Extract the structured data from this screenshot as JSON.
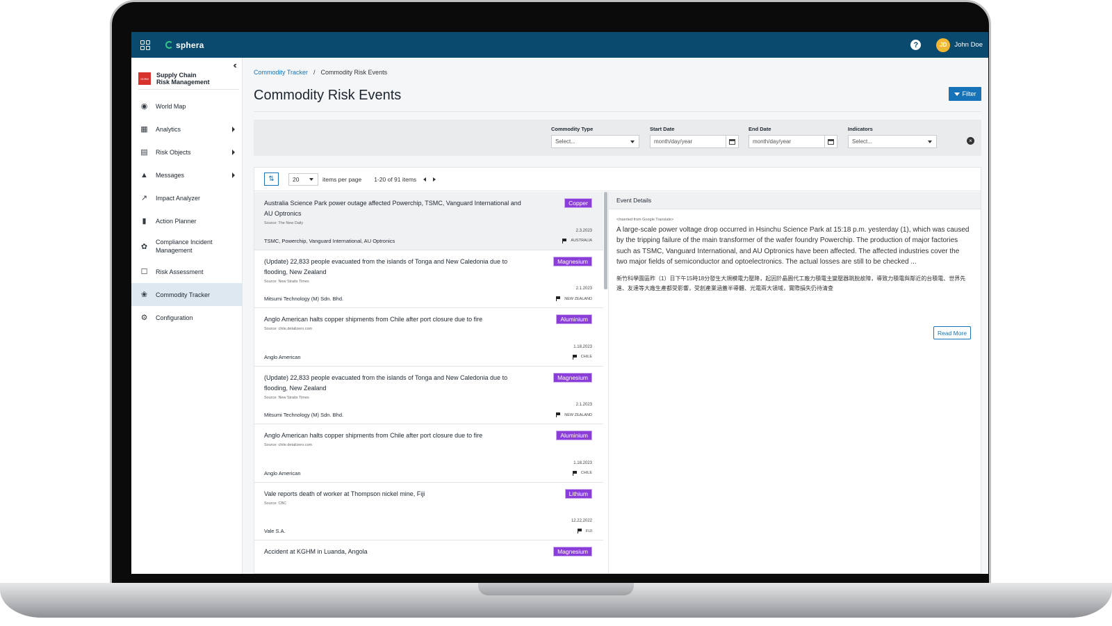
{
  "brand": {
    "name": "sphera"
  },
  "user": {
    "initials": "JD",
    "name": "John Doe"
  },
  "sidebar": {
    "app_logo_text": "SCRM",
    "app_name": "Supply Chain\nRisk Management",
    "items": [
      {
        "label": "World Map",
        "icon": "globe-icon",
        "has_submenu": false
      },
      {
        "label": "Analytics",
        "icon": "bar-chart-icon",
        "has_submenu": true
      },
      {
        "label": "Risk Objects",
        "icon": "table-icon",
        "has_submenu": true
      },
      {
        "label": "Messages",
        "icon": "bell-icon",
        "has_submenu": true
      },
      {
        "label": "Impact Analyzer",
        "icon": "line-chart-icon",
        "has_submenu": false
      },
      {
        "label": "Action Planner",
        "icon": "pin-icon",
        "has_submenu": false
      },
      {
        "label": "Compliance Incident Management",
        "icon": "leaf-icon",
        "has_submenu": false
      },
      {
        "label": "Risk Assessment",
        "icon": "clipboard-icon",
        "has_submenu": false
      },
      {
        "label": "Commodity Tracker",
        "icon": "commodity-icon",
        "has_submenu": false,
        "active": true
      },
      {
        "label": "Configuration",
        "icon": "gear-icon",
        "has_submenu": false
      }
    ]
  },
  "breadcrumb": {
    "parent": "Commodity Tracker",
    "separator": "/",
    "current": "Commodity Risk Events"
  },
  "page": {
    "title": "Commodity Risk Events",
    "filter_button": "Filter"
  },
  "filters": {
    "commodity_type": {
      "label": "Commodity Type",
      "placeholder": "Select..."
    },
    "start_date": {
      "label": "Start Date",
      "placeholder": "month/day/year"
    },
    "end_date": {
      "label": "End Date",
      "placeholder": "month/day/year"
    },
    "indicators": {
      "label": "Indicators",
      "placeholder": "Select..."
    }
  },
  "pagination": {
    "per_page_value": "20",
    "per_page_label": "items per page",
    "range": "1-20 of 91 items"
  },
  "events": [
    {
      "title": "Australia Science Park power outage affected Powerchip, TSMC, Vanguard International and AU Optronics",
      "source": "Source: The New Daily",
      "date": "2.3.2023",
      "companies": "TSMC, Powerchip, Vanguard International, AU Optronics",
      "country": "AUSTRALIA",
      "commodity": "Copper",
      "selected": true
    },
    {
      "title": "(Update) 22,833 people evacuated from the islands of Tonga and New Caledonia due to flooding, New Zealand",
      "source": "Source: New Straits Times",
      "date": "2.1.2023",
      "companies": "Mitsumi Technology (M) Sdn. Bhd.",
      "country": "NEW ZEALAND",
      "commodity": "Magnesium"
    },
    {
      "title": "Anglo American halts copper shipments from Chile after port closure due to fire",
      "source": "Source: chile.detalizero.com",
      "date": "1.18.2023",
      "companies": "Anglo American",
      "country": "CHILE",
      "commodity": "Aluminium"
    },
    {
      "title": "(Update) 22,833 people evacuated from the islands of Tonga and New Caledonia due to flooding, New Zealand",
      "source": "Source: New Straits Times",
      "date": "2.1.2023",
      "companies": "Mitsumi Technology (M) Sdn. Bhd.",
      "country": "NEW ZEALAND",
      "commodity": "Magnesium"
    },
    {
      "title": "Anglo American halts copper shipments from Chile after port closure due to fire",
      "source": "Source: chile.detalizero.com",
      "date": "1.18.2023",
      "companies": "Anglo American",
      "country": "CHILE",
      "commodity": "Aluminium"
    },
    {
      "title": "Vale reports death of worker at Thompson nickel mine, Fiji",
      "source": "Source: CBC",
      "date": "12.22.2022",
      "companies": "Vale S.A.",
      "country": "FIJI",
      "commodity": "Lithium"
    },
    {
      "title": "Accident at KGHM in Luanda, Angola",
      "source": "",
      "date": "",
      "companies": "",
      "country": "",
      "commodity": "Magnesium"
    }
  ],
  "details": {
    "header": "Event Details",
    "note": "<Inserted from Google Translate>",
    "text_en": "A large-scale power voltage drop occurred in Hsinchu Science Park at 15:18 p.m. yesterday (1), which was caused by the tripping failure of the main transformer of the wafer foundry Powerchip. The production of major factories such as TSMC, Vanguard International, and AU Optronics have been affected. The affected industries cover the two major fields of semiconductor and optoelectronics. The actual losses are still to be checked ...",
    "text_zh": "新竹科學園區昨（1）日下午15時18分發生大規模電力壓降，起因於晶圓代工廠力積電主變壓器跳脫故障，導致力積電與鄰近的台積電、世界先進、友達等大廠生產都受影響，受創產業涵蓋半導體、光電兩大領域，實際損失仍待清查",
    "read_more": "Read More"
  }
}
